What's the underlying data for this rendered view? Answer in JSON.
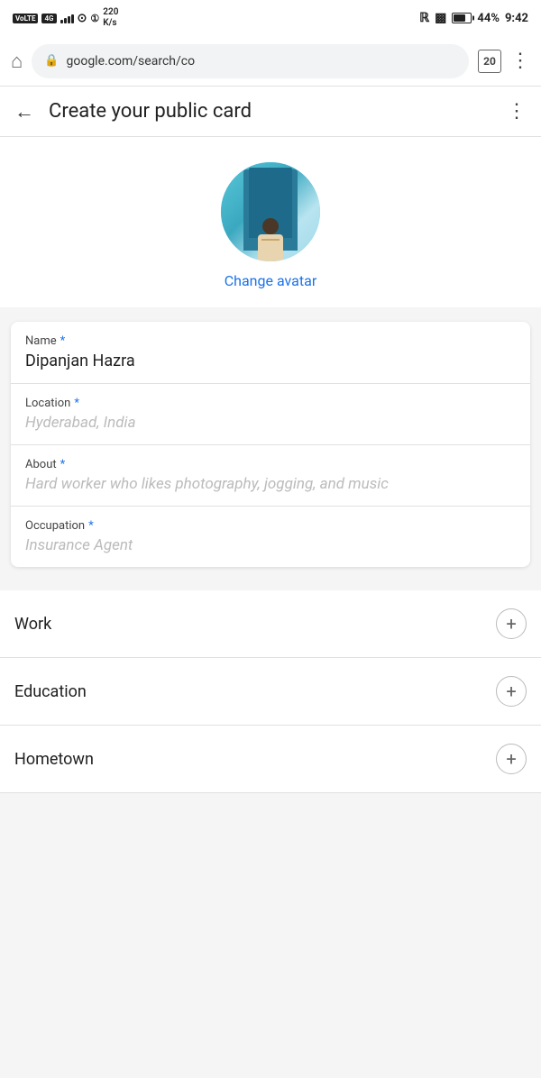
{
  "statusBar": {
    "volte": "VoLTE",
    "network": "4G",
    "signal": "4G",
    "wifi": "wifi",
    "simInfo": "1",
    "speed": "220\nK/s",
    "bluetooth": "BT",
    "vibrate": "vibrate",
    "battery": "44",
    "time": "9:42"
  },
  "browserBar": {
    "url": "google.com/search/co",
    "tabCount": "20"
  },
  "header": {
    "title": "Create your public card",
    "backLabel": "←",
    "menuLabel": "⋮"
  },
  "avatar": {
    "changeLabel": "Change avatar"
  },
  "form": {
    "fields": [
      {
        "label": "Name",
        "required": true,
        "value": "Dipanjan Hazra",
        "placeholder": ""
      },
      {
        "label": "Location",
        "required": true,
        "value": "",
        "placeholder": "Hyderabad, India"
      },
      {
        "label": "About",
        "required": true,
        "value": "",
        "placeholder": "Hard worker who likes photography, jogging, and music"
      },
      {
        "label": "Occupation",
        "required": true,
        "value": "",
        "placeholder": "Insurance Agent"
      }
    ]
  },
  "expandSections": [
    {
      "label": "Work"
    },
    {
      "label": "Education"
    },
    {
      "label": "Hometown"
    }
  ]
}
